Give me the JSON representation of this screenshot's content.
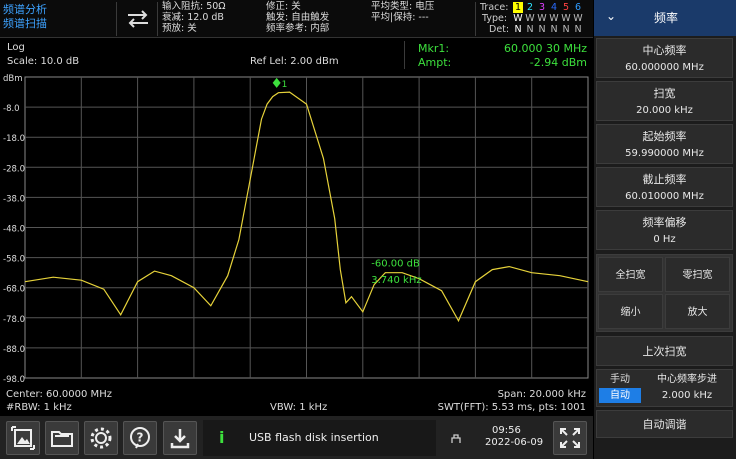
{
  "mode": {
    "line1": "频谱分析",
    "line2": "频谱扫描"
  },
  "settings": {
    "c1": [
      "输入阻抗: 50Ω",
      "衰减: 12.0 dB",
      "预放: 关"
    ],
    "c2": [
      "修正: 关",
      "触发: 自由触发",
      "频率参考: 内部"
    ],
    "c3": [
      "平均类型: 电压",
      "平均|保持: ---"
    ]
  },
  "trace": {
    "labels": [
      "Trace:",
      "Type:",
      "Det:"
    ],
    "nums": [
      "1",
      "2",
      "3",
      "4",
      "5",
      "6"
    ],
    "types": [
      "W",
      "W",
      "W",
      "W",
      "W",
      "W"
    ],
    "dets": [
      "N",
      "N",
      "N",
      "N",
      "N",
      "N"
    ],
    "num_colors": [
      "#ffff00",
      "#2ee6ff",
      "#e040ff",
      "#2a6cff",
      "#ff4040",
      "#2f9cff"
    ]
  },
  "info": {
    "scale_type": "Log",
    "scale": "Scale: 10.0 dB",
    "ref_level": "Ref Lel: 2.00 dBm",
    "mkr_label": "Mkr1:",
    "mkr_freq": "60.000 30 MHz",
    "ampt_label": "Ampt:",
    "ampt_value": "-2.94 dBm"
  },
  "chart_data": {
    "type": "line",
    "ylabels": [
      "dBm",
      "-8.0",
      "-18.0",
      "-28.0",
      "-38.0",
      "-48.0",
      "-58.0",
      "-68.0",
      "-78.0",
      "-88.0",
      "-98.0"
    ],
    "ylim": [
      -98,
      2
    ],
    "grid": true,
    "series": [
      {
        "color": "#e6d23a",
        "x": [
          0,
          0.05,
          0.1,
          0.14,
          0.17,
          0.2,
          0.23,
          0.26,
          0.3,
          0.33,
          0.36,
          0.38,
          0.4,
          0.42,
          0.43,
          0.44,
          0.45,
          0.47,
          0.5,
          0.53,
          0.55,
          0.56,
          0.57,
          0.58,
          0.6,
          0.62,
          0.64,
          0.67,
          0.7,
          0.74,
          0.77,
          0.8,
          0.83,
          0.86,
          0.9,
          0.95,
          1
        ],
        "y": [
          -66,
          -64.5,
          -65.5,
          -68.5,
          -77,
          -66,
          -62.5,
          -64,
          -68,
          -74,
          -64,
          -52,
          -32,
          -12,
          -7,
          -4.5,
          -3.2,
          -3,
          -7,
          -25,
          -45,
          -62,
          -73,
          -71,
          -76,
          -67,
          -63,
          -63,
          -65,
          -69,
          -79,
          -66,
          -62,
          -61,
          -63,
          -64,
          -66
        ]
      }
    ],
    "marker": {
      "label": "1",
      "x": 0.447,
      "y": -2.94
    },
    "annotation": {
      "line1": "-60.00 dB",
      "line2": "3.740 kHz"
    }
  },
  "footer": {
    "center": "Center: 60.0000 MHz",
    "span": "Span: 20.000 kHz",
    "rbw": "#RBW: 1 kHz",
    "vbw": "VBW: 1 kHz",
    "swt": "SWT(FFT): 5.53 ms, pts: 1001"
  },
  "bottom": {
    "message": "USB flash disk insertion",
    "time": "09:56",
    "date": "2022-06-09"
  },
  "side": {
    "title": "频率",
    "center_label": "中心频率",
    "center_value": "60.000000 MHz",
    "span_label": "扫宽",
    "span_value": "20.000 kHz",
    "start_label": "起始频率",
    "start_value": "59.990000 MHz",
    "stop_label": "截止频率",
    "stop_value": "60.010000 MHz",
    "offset_label": "频率偏移",
    "offset_value": "0 Hz",
    "full_span": "全扫宽",
    "zero_span": "零扫宽",
    "zoom_in": "缩小",
    "zoom_out": "放大",
    "last_span": "上次扫宽",
    "manual": "手动",
    "auto": "自动",
    "step_label": "中心频率步进",
    "step_value": "2.000 kHz",
    "auto_tune": "自动调谐"
  }
}
